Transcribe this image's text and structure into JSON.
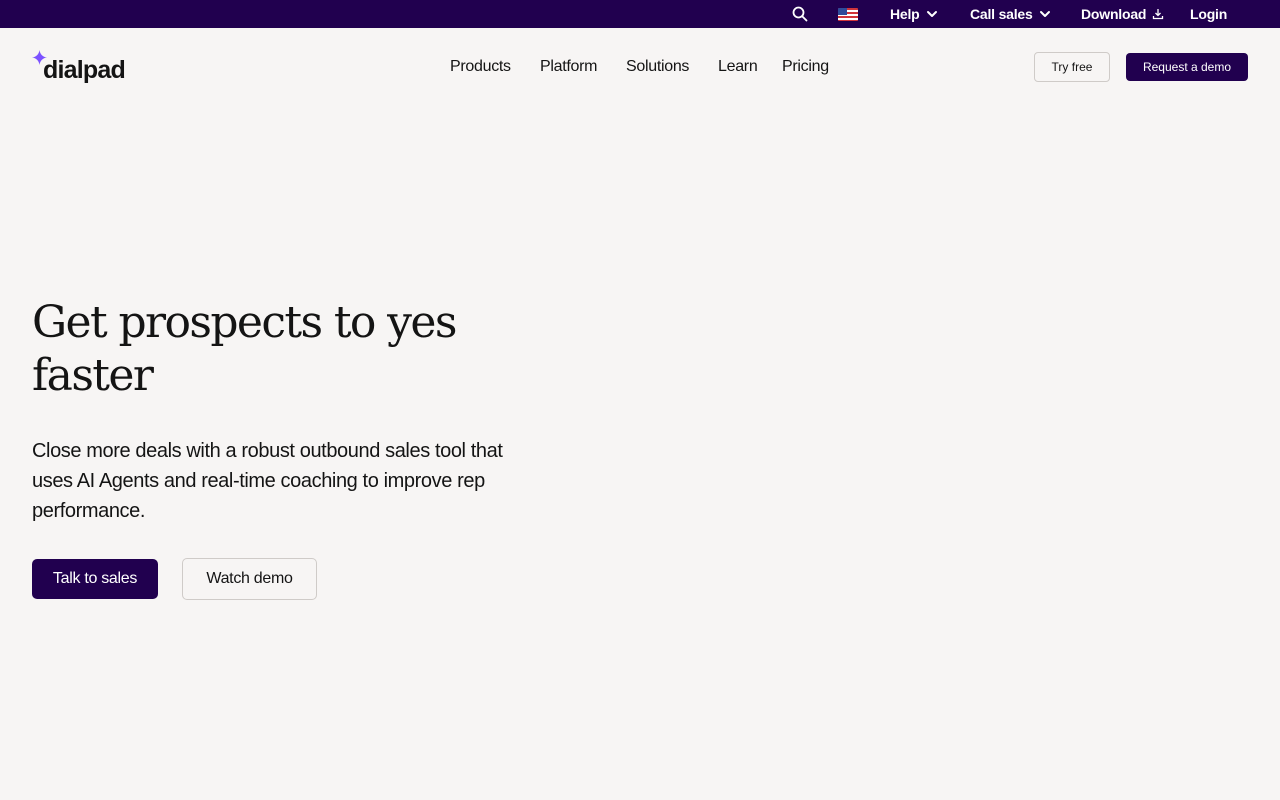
{
  "utility_bar": {
    "search_icon": "search-icon",
    "flag_icon": "us-flag-icon",
    "help_label": "Help",
    "call_sales_label": "Call sales",
    "download_label": "Download",
    "login_label": "Login"
  },
  "header": {
    "logo_text": "dialpad",
    "nav": [
      "Products",
      "Platform",
      "Solutions",
      "Learn",
      "Pricing"
    ],
    "try_free_label": "Try free",
    "request_demo_label": "Request a demo"
  },
  "hero": {
    "title_line1": "Get prospects to yes",
    "title_line2": "faster",
    "subtitle": "Close more deals with a robust outbound sales tool that uses AI Agents and real-time coaching to improve rep performance.",
    "primary_cta": "Talk to sales",
    "secondary_cta": "Watch demo"
  },
  "colors": {
    "brand_dark": "#21004f",
    "page_background": "#f7f5f4",
    "sparkle": "#7c52ff"
  }
}
